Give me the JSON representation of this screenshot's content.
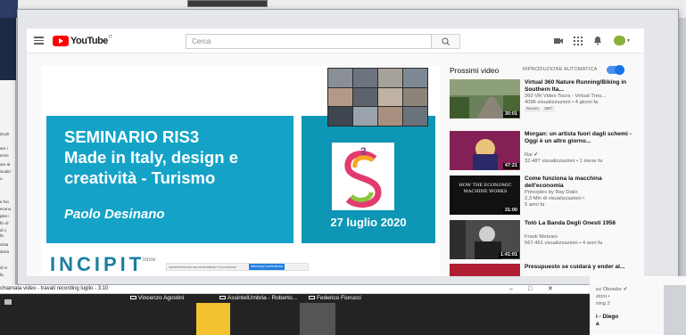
{
  "background": {
    "left_panel_snippets": [
      "DUZI",
      "are i",
      "enze",
      "are al",
      "isualiz",
      "o",
      "e fun",
      "econo",
      "ples i",
      "fin di",
      "di v",
      "fa",
      "vista",
      "dona",
      "di vi",
      "fa"
    ]
  },
  "youtube": {
    "logo_text": "YouTube",
    "logo_sup": "IT",
    "search_placeholder": "Cerca",
    "header_icons": [
      "video-camera-icon",
      "apps-grid-icon",
      "bell-icon",
      "avatar"
    ]
  },
  "video": {
    "slide_title_lines": [
      "SEMINARIO RIS3",
      "Made in Italy, design e",
      "creatività - Turismo"
    ],
    "slide_author": "Paolo Desinano",
    "slide_date": "27 luglio 2020",
    "footer_logo": "INCIPIT",
    "footer_text": "Innov",
    "cookie_text": "investirenell.com sta condividendo il tuo schermo",
    "cookie_button": "Interrompi condivisione",
    "cookie_hide": "Nascondi"
  },
  "sidebar": {
    "up_next": "Prossimi video",
    "autoplay_label": "RIPRODUZIONE AUTOMATICA",
    "autoplay_on": true,
    "recommendations": [
      {
        "title": "Virtual 360 Nature Running/Biking in Southern Ita...",
        "channel": "360 VR Video Tours - Virtual Trea...",
        "meta": "4096 visualizzazioni • 4 giorni fa",
        "badges": [
          "Nuovo",
          "360°"
        ],
        "duration": "30:01"
      },
      {
        "title": "Morgan: un artista fuori dagli schemi - Oggi è un altro giorno...",
        "channel": "Rai ✔",
        "meta": "32.487 visualizzazioni • 1 mese fa",
        "badges": [],
        "duration": "47:21"
      },
      {
        "title": "Come funziona la macchina dell'economia",
        "channel": "Principles by Ray Dalio",
        "meta": "2,3 Mln di visualizzazioni •",
        "meta2": "5 anni fa",
        "badges": [],
        "duration": "31:00",
        "thumb_text": "HOW THE ECONOMIC MACHINE WORKS"
      },
      {
        "title": "Totò La Banda Degli Onesti 1956",
        "channel": "Frank Metzani",
        "meta": "567.461 visualizzazioni • 4 anni fa",
        "badges": [],
        "duration": "1:41:01"
      },
      {
        "title": "Presupuesto se cuidará y ender al...",
        "channel": "ez Obrador ✔",
        "meta": "zioni •",
        "meta2": "ning 2",
        "badges": [],
        "duration": ""
      }
    ],
    "partial_next_title": "i - Diego",
    "partial_next_line2": "a"
  },
  "zoom": {
    "window_title": "chiamata video - travati recording luglio - 3:10",
    "controls": [
      "–",
      "□",
      "✕"
    ],
    "participants": [
      "Vincenzo Agostini",
      "AssintelUmbria - Roberto...",
      "Federico Fiorucci"
    ]
  }
}
